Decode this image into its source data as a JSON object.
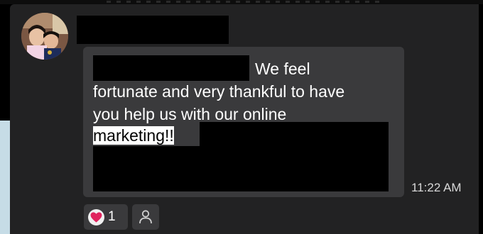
{
  "message": {
    "line1": "We feel",
    "line2": "fortunate and very thankful to have",
    "line3": "you help us with our online",
    "line4": "marketing!!",
    "timestamp": "11:22 AM"
  },
  "reactions": [
    {
      "icon": "heart-icon",
      "count": "1",
      "color": "#e0245e"
    }
  ],
  "add_reaction_icon": "person-icon",
  "colors": {
    "pane_bg": "#222223",
    "bubble_bg": "#3a3a3c",
    "text": "#ffffff",
    "timestamp": "#d8d8d8"
  }
}
